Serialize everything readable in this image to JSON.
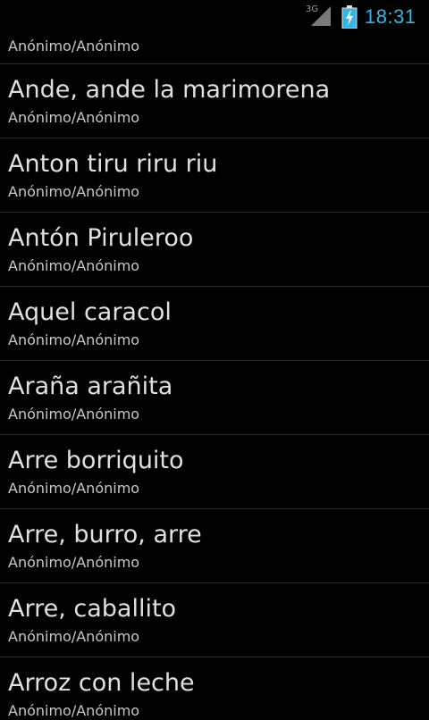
{
  "status_bar": {
    "network_type": "3G",
    "time": "18:31",
    "icons": [
      "signal-icon",
      "battery-charging-icon"
    ]
  },
  "list": {
    "partial_top_subtitle": "Anónimo/Anónimo",
    "items": [
      {
        "title": "Ande, ande la marimorena",
        "subtitle": "Anónimo/Anónimo"
      },
      {
        "title": "Anton tiru riru riu",
        "subtitle": "Anónimo/Anónimo"
      },
      {
        "title": "Antón Piruleroo",
        "subtitle": "Anónimo/Anónimo"
      },
      {
        "title": "Aquel caracol",
        "subtitle": "Anónimo/Anónimo"
      },
      {
        "title": "Araña arañita",
        "subtitle": "Anónimo/Anónimo"
      },
      {
        "title": "Arre borriquito",
        "subtitle": "Anónimo/Anónimo"
      },
      {
        "title": "Arre, burro, arre",
        "subtitle": "Anónimo/Anónimo"
      },
      {
        "title": "Arre, caballito",
        "subtitle": "Anónimo/Anónimo"
      },
      {
        "title": "Arroz con leche",
        "subtitle": "Anónimo/Anónimo"
      }
    ]
  },
  "colors": {
    "background": "#000000",
    "clock": "#33b5e5",
    "divider": "#2a2a2a",
    "battery_fill": "#33b5e5"
  }
}
